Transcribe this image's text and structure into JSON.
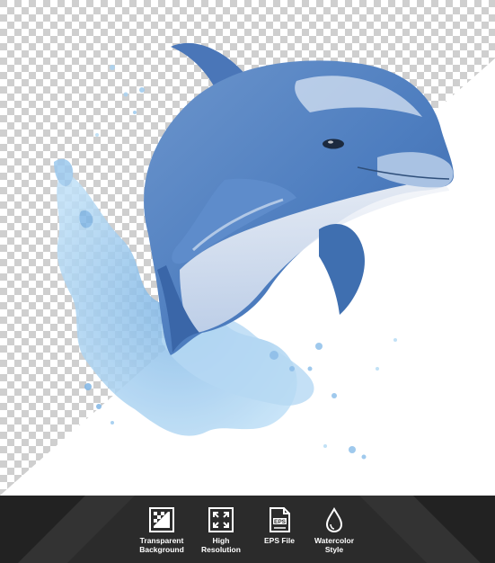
{
  "image": {
    "subject": "dolphin-watercolor-illustration",
    "background": "transparency-checkerboard",
    "colors": {
      "dolphin_dark": "#3f6fb0",
      "dolphin_mid": "#7fa6d6",
      "dolphin_light": "#eef1f6",
      "splash": "#9cc9ee",
      "checker_light": "#ffffff",
      "checker_dark": "#cfcfcf",
      "footer_bg": "#2b2b2b"
    }
  },
  "features": [
    {
      "icon": "checker-square-icon",
      "line1": "Transparent",
      "line2": "Background"
    },
    {
      "icon": "expand-arrows-icon",
      "line1": "High",
      "line2": "Resolution"
    },
    {
      "icon": "file-icon",
      "badge": "EPS",
      "line1": "EPS File",
      "line2": ""
    },
    {
      "icon": "drop-icon",
      "line1": "Watercolor",
      "line2": "Style"
    }
  ]
}
